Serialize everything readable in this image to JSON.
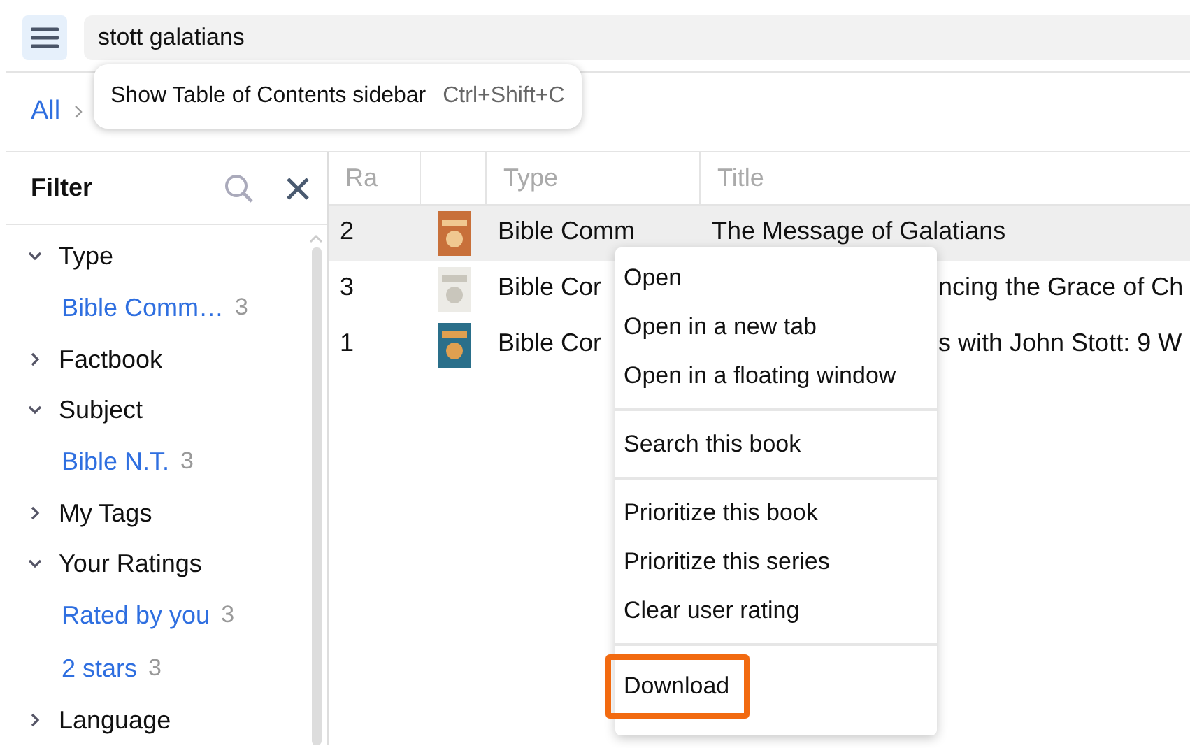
{
  "search": {
    "value": "stott galatians"
  },
  "tooltip": {
    "label": "Show Table of Contents sidebar",
    "shortcut": "Ctrl+Shift+C"
  },
  "breadcrumb": [
    "All"
  ],
  "filter": {
    "title": "Filter",
    "groups": [
      {
        "label": "Type",
        "expanded": true,
        "children": [
          {
            "label": "Bible Comm…",
            "count": "3"
          }
        ]
      },
      {
        "label": "Factbook",
        "expanded": false
      },
      {
        "label": "Subject",
        "expanded": true,
        "children": [
          {
            "label": "Bible N.T.",
            "count": "3"
          }
        ]
      },
      {
        "label": "My Tags",
        "expanded": false
      },
      {
        "label": "Your Ratings",
        "expanded": true,
        "children": [
          {
            "label": "Rated by you",
            "count": "3"
          },
          {
            "label": "2 stars",
            "count": "3"
          }
        ]
      },
      {
        "label": "Language",
        "expanded": false
      }
    ]
  },
  "table": {
    "columns": [
      "Ra",
      "",
      "Type",
      "Title"
    ],
    "rows": [
      {
        "rating": "2",
        "type": "Bible Comm",
        "title": "The Message of Galatians",
        "selected": true
      },
      {
        "rating": "3",
        "type": "Bible Cor",
        "title": "ncing the Grace of Ch",
        "selected": false
      },
      {
        "rating": "1",
        "type": "Bible Cor",
        "title": "s with John Stott: 9 W",
        "selected": false
      }
    ]
  },
  "context_menu": [
    [
      {
        "label": "Open",
        "highlighted": false
      },
      {
        "label": "Open in a new tab",
        "highlighted": false
      },
      {
        "label": "Open in a floating window",
        "highlighted": false
      }
    ],
    [
      {
        "label": "Search this book",
        "highlighted": false
      }
    ],
    [
      {
        "label": "Prioritize this book",
        "highlighted": false
      },
      {
        "label": "Prioritize this series",
        "highlighted": false
      },
      {
        "label": "Clear user rating",
        "highlighted": false
      }
    ],
    [
      {
        "label": "Download",
        "highlighted": true
      }
    ]
  ]
}
